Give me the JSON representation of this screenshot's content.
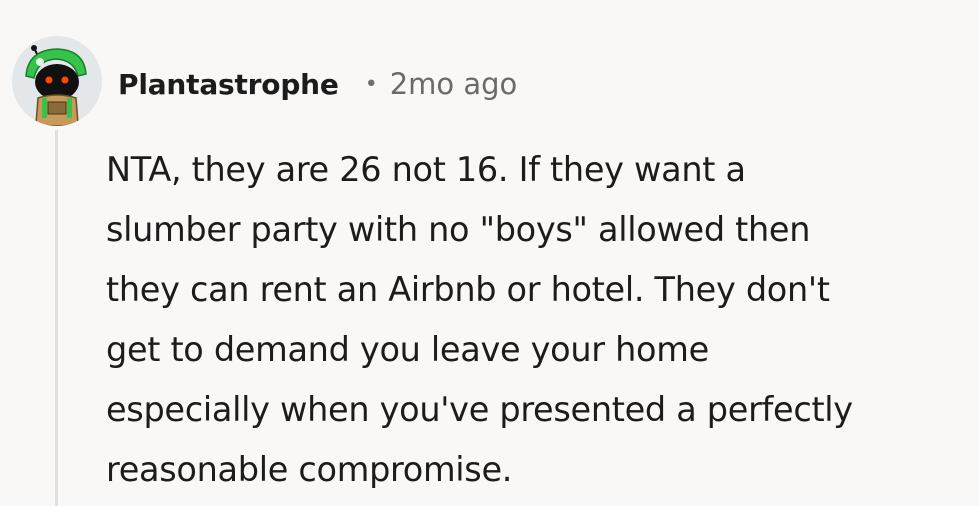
{
  "comment": {
    "author": "Plantastrophe",
    "separator": "•",
    "timestamp": "2mo ago",
    "avatar_icon": "snoo-avatar-icon",
    "body": "NTA, they are 26 not 16. If they want a\nslumber party with no \"boys\" allowed then\nthey can rent an Airbnb or hotel. They don't\nget to demand you leave your home\nespecially when you've presented a perfectly\nreasonable compromise."
  },
  "colors": {
    "background": "#f9f8f6",
    "text": "#1c1c1c",
    "meta_text": "#6a6a6a",
    "thread_line": "#e3e0dc",
    "avatar_bg": "#e4e7ea"
  }
}
